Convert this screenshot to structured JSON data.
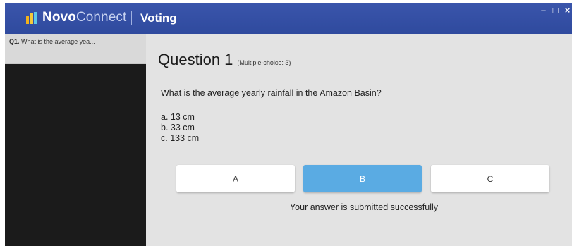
{
  "titlebar": {
    "app_name_bold": "Novo",
    "app_name_light": "Connect",
    "window_title": "Voting",
    "minimize_glyph": "–",
    "maximize_glyph": "□",
    "close_glyph": "×"
  },
  "sidebar": {
    "items": [
      {
        "number": "Q1.",
        "label": "What is the average yea..."
      }
    ]
  },
  "question": {
    "heading": "Question 1",
    "type_note": "(Multiple-choice: 3)",
    "text": "What is the average yearly rainfall in the Amazon Basin?",
    "options": [
      "a. 13 cm",
      "b. 33 cm",
      "c. 133 cm"
    ]
  },
  "answers": {
    "buttons": [
      "A",
      "B",
      "C"
    ],
    "selected": "B"
  },
  "status": {
    "message": "Your answer is submitted successfully"
  },
  "colors": {
    "titlebar": "#2f4a9e",
    "selected_button": "#5aabe3",
    "sidebar_bg": "#1b1b1b",
    "content_bg": "#e3e3e3"
  }
}
